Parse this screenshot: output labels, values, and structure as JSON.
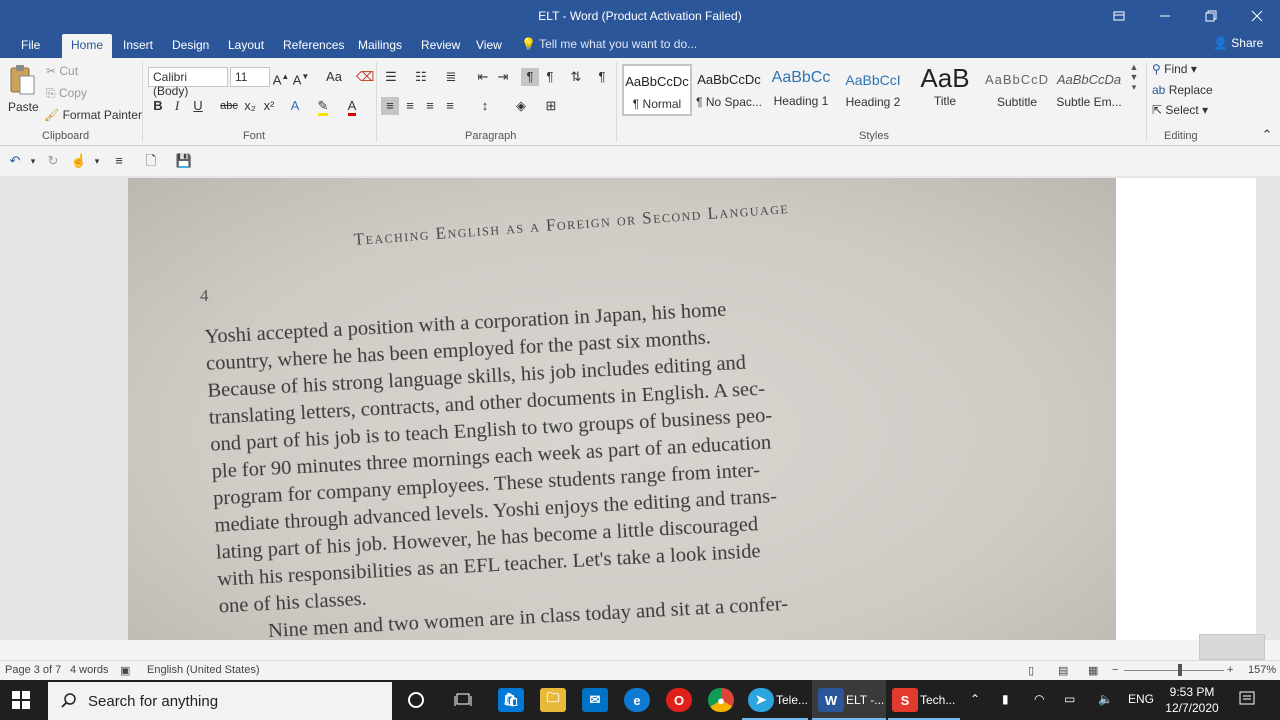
{
  "window": {
    "title": "ELT - Word (Product Activation Failed)",
    "buttons": {
      "minimize": "—",
      "restore": "❐",
      "close": "✕",
      "ribbon_display": "▭"
    }
  },
  "ribbon_tabs": [
    "File",
    "Home",
    "Insert",
    "Design",
    "Layout",
    "References",
    "Mailings",
    "Review",
    "View"
  ],
  "tell_me": "Tell me what you want to do...",
  "share": "Share",
  "clipboard": {
    "paste": "Paste",
    "cut": "Cut",
    "copy": "Copy",
    "format_painter": "Format Painter",
    "label": "Clipboard"
  },
  "font": {
    "name": "Calibri (Body)",
    "size": "11",
    "label": "Font",
    "bold": "B",
    "italic": "I",
    "underline": "U",
    "strike": "abc",
    "sub": "x₂",
    "sup": "x²",
    "case": "Aa"
  },
  "paragraph": {
    "label": "Paragraph"
  },
  "styles": {
    "label": "Styles",
    "items": [
      {
        "preview": "AaBbCcDc",
        "name": "¶ Normal"
      },
      {
        "preview": "AaBbCcDc",
        "name": "¶ No Spac..."
      },
      {
        "preview": "AaBbCc",
        "name": "Heading 1"
      },
      {
        "preview": "AaBbCcI",
        "name": "Heading 2"
      },
      {
        "preview": "AaB",
        "name": "Title"
      },
      {
        "preview": "AaBbCcD",
        "name": "Subtitle"
      },
      {
        "preview": "AaBbCcDa",
        "name": "Subtle Em..."
      }
    ]
  },
  "editing": {
    "find": "Find",
    "replace": "Replace",
    "select": "Select",
    "label": "Editing"
  },
  "document": {
    "header": "Teaching English as a Foreign or Second Language",
    "page_number": "4",
    "lines": [
      "Yoshi accepted a position with a corporation in Japan, his home",
      "country, where he has been employed for the past six months.",
      "Because of his strong language skills, his job includes editing and",
      "translating letters, contracts, and other documents in English. A sec-",
      "ond part of his job is to teach English to two groups of business peo-",
      "ple for 90 minutes three mornings each week as part of an education",
      "program for company employees. These students range from inter-",
      "mediate through advanced levels. Yoshi enjoys the editing and trans-",
      "lating part of his job. However, he has become a little discouraged",
      "with his responsibilities as an EFL teacher. Let's take a look inside",
      "one of his classes.",
      "Nine men and two women are in class today and sit at a confer-"
    ]
  },
  "status": {
    "page": "Page 3 of 7",
    "words": "4 words",
    "language": "English (United States)",
    "zoom": "157%"
  },
  "taskbar": {
    "search_placeholder": "Search for anything",
    "apps": [
      {
        "name": "Tele...",
        "kind": "telegram"
      },
      {
        "name": "ELT -...",
        "kind": "word"
      },
      {
        "name": "Tech...",
        "kind": "slides"
      }
    ],
    "lang": "ENG",
    "time": "9:53 PM",
    "date": "12/7/2020"
  },
  "colors": {
    "word_blue": "#2b579a",
    "taskbar": "#1f1f1f"
  }
}
